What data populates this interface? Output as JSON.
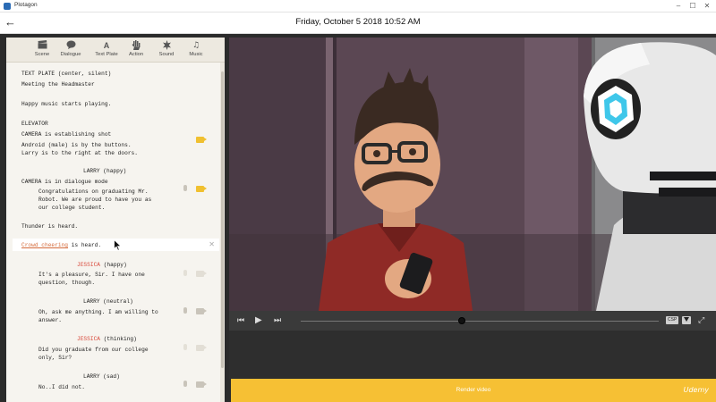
{
  "window": {
    "title": "Plotagon",
    "controls": [
      "–",
      "☐",
      "✕"
    ]
  },
  "header": {
    "back_glyph": "←",
    "date_time": "Friday, October 5 2018 10:52 AM"
  },
  "toolbar": {
    "items": [
      {
        "label": "Scene",
        "icon": "clapperboard-icon",
        "glyph": "🎬"
      },
      {
        "label": "Dialogue",
        "icon": "speech-bubble-icon",
        "glyph": "💬"
      },
      {
        "label": "Text Plate",
        "icon": "text-plate-icon",
        "glyph": "A"
      },
      {
        "label": "Action",
        "icon": "hand-icon",
        "glyph": "✋"
      },
      {
        "label": "Sound",
        "icon": "sound-icon",
        "glyph": "✹"
      },
      {
        "label": "Music",
        "icon": "music-note-icon",
        "glyph": "♫"
      }
    ]
  },
  "script": {
    "text_plate_header": "TEXT PLATE (center, silent)",
    "text_plate_body": "Meeting the Headmaster",
    "music_line": "Happy music starts playing.",
    "scene_title": "ELEVATOR",
    "camera1": "CAMERA is establishing shot",
    "stage1a": "Android (male) is by the buttons.",
    "stage1b": "Larry is to the right at the doors.",
    "speaker1": "LARRY (happy)",
    "camera2": "CAMERA is in dialogue mode",
    "dialog1a": "Congratulations on graduating Mr.",
    "dialog1b": "Robot. We are proud to have you as",
    "dialog1c": "our college student.",
    "sound1": "Thunder is heard.",
    "sound2_link": "Crowd cheering",
    "sound2_rest": " is heard.",
    "speaker2_name": "JESSICA",
    "speaker2_mood": " (happy)",
    "dialog2a": "It's a pleasure, Sir. I have one",
    "dialog2b": "question, though.",
    "speaker3": "LARRY (neutral)",
    "dialog3a": "Oh, ask me anything. I am willing to",
    "dialog3b": "answer.",
    "speaker4_name": "JESSICA",
    "speaker4_mood": " (thinking)",
    "dialog4a": "Did you graduate from our college",
    "dialog4b": "only, Sir?",
    "speaker5": "LARRY (sad)",
    "dialog5a": "No..I did not."
  },
  "player": {
    "prev_glyph": "⏮",
    "play_glyph": "▶",
    "next_glyph": "⏭",
    "playback_fraction": 0.45,
    "badge1": "CSP",
    "fullscreen_glyph": "⤢"
  },
  "render_button": {
    "label": "Render video"
  },
  "watermark": "Udemy",
  "colors": {
    "accent": "#f6c034",
    "character_red": "#d94b3d",
    "link": "#d46a3a"
  }
}
